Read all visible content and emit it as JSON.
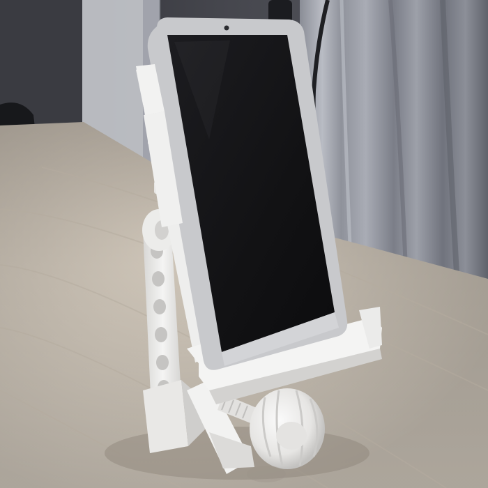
{
  "scene": {
    "subjects": [
      "smartphone",
      "3d-printed-phone-stand",
      "wooden-desk",
      "curtain",
      "wall"
    ],
    "colors": {
      "wall_dark": "#3c3d43",
      "wall_light": "#6e7078",
      "curtain_light": "#b9bcc4",
      "curtain_dark": "#7d808a",
      "desk_light": "#d9d0c3",
      "desk_dark": "#a69d92",
      "stand_white": "#f1f1f0",
      "stand_shadow": "#c9c8c6",
      "phone_screen": "#141416",
      "phone_frame": "#c8c9cc"
    }
  }
}
